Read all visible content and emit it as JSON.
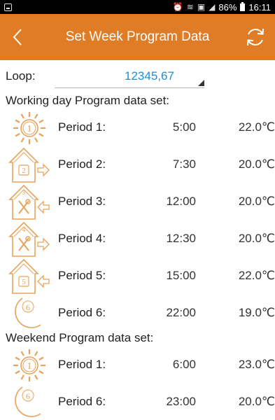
{
  "status_bar": {
    "battery": "86%",
    "time": "16:11",
    "icons": [
      "alarm-icon",
      "wifi-icon",
      "nfc-icon",
      "signal-icon",
      "battery-icon"
    ]
  },
  "header": {
    "title": "Set Week Program Data",
    "back_icon": "chevron-left-icon",
    "refresh_icon": "refresh-icon"
  },
  "loop": {
    "label": "Loop:",
    "value": "12345,67"
  },
  "working_day": {
    "title": "Working day Program data set:",
    "periods": [
      {
        "label": "Period 1:",
        "time": "5:00",
        "temp": "22.0℃",
        "icon": "sun-icon",
        "num": "1"
      },
      {
        "label": "Period 2:",
        "time": "7:30",
        "temp": "20.0℃",
        "icon": "house-leave-icon",
        "num": "2"
      },
      {
        "label": "Period 3:",
        "time": "12:00",
        "temp": "20.0℃",
        "icon": "house-meal-return-icon",
        "num": "3"
      },
      {
        "label": "Period 4:",
        "time": "12:30",
        "temp": "20.0℃",
        "icon": "house-meal-leave-icon",
        "num": "4"
      },
      {
        "label": "Period 5:",
        "time": "15:00",
        "temp": "22.0℃",
        "icon": "house-return-icon",
        "num": "5"
      },
      {
        "label": "Period 6:",
        "time": "22:00",
        "temp": "19.0℃",
        "icon": "moon-icon",
        "num": "6"
      }
    ]
  },
  "weekend": {
    "title": "Weekend Program data set:",
    "periods": [
      {
        "label": "Period 1:",
        "time": "6:00",
        "temp": "23.0℃",
        "icon": "sun-icon",
        "num": "1"
      },
      {
        "label": "Period 6:",
        "time": "23:00",
        "temp": "20.0℃",
        "icon": "moon-icon",
        "num": "6"
      }
    ]
  },
  "colors": {
    "accent": "#e07c25",
    "icon_stroke": "#e8a35a",
    "link": "#1a8fd6"
  }
}
